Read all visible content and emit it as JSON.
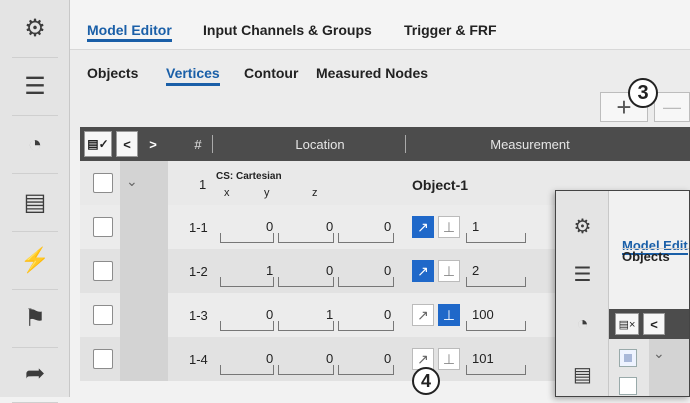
{
  "sidebar": {
    "items": [
      {
        "name": "settings-gear-icon",
        "glyph": "⚙"
      },
      {
        "name": "list-icon",
        "glyph": "☰"
      },
      {
        "name": "gauge-icon",
        "glyph": "◔"
      },
      {
        "name": "report-icon",
        "glyph": "▤"
      },
      {
        "name": "lightning-icon",
        "glyph": "⚡"
      },
      {
        "name": "flag-icon",
        "glyph": "⚑"
      },
      {
        "name": "share-export-icon",
        "glyph": "➦"
      }
    ]
  },
  "main_tabs": [
    "Model Editor",
    "Input Channels & Groups",
    "Trigger & FRF"
  ],
  "active_main_tab": "Model Editor",
  "sub_tabs": [
    "Objects",
    "Vertices",
    "Contour",
    "Measured Nodes"
  ],
  "active_sub_tab": "Vertices",
  "toolbar": {
    "add_glyph": "+",
    "callout_3": "3",
    "callout_4": "4"
  },
  "table": {
    "header": {
      "hash": "#",
      "location": "Location",
      "measurement": "Measurement"
    },
    "group": {
      "index": "1",
      "cs_label": "CS: Cartesian",
      "axes": [
        "x",
        "y",
        "z"
      ],
      "object_label": "Object-1"
    },
    "rows": [
      {
        "id": "1-1",
        "x": "0",
        "y": "0",
        "z": "0",
        "meas": "1",
        "mode": "first"
      },
      {
        "id": "1-2",
        "x": "1",
        "y": "0",
        "z": "0",
        "meas": "2",
        "mode": "first"
      },
      {
        "id": "1-3",
        "x": "0",
        "y": "1",
        "z": "0",
        "meas": "100",
        "mode": "second"
      },
      {
        "id": "1-4",
        "x": "0",
        "y": "0",
        "z": "0",
        "meas": "101",
        "mode": "none"
      }
    ]
  },
  "overlay": {
    "tab_label": "Model Edit",
    "sub_label": "Objects"
  },
  "colors": {
    "accent": "#1a5fa8",
    "active_icon": "#1f68c9",
    "header_bg": "#4c4c4c"
  }
}
